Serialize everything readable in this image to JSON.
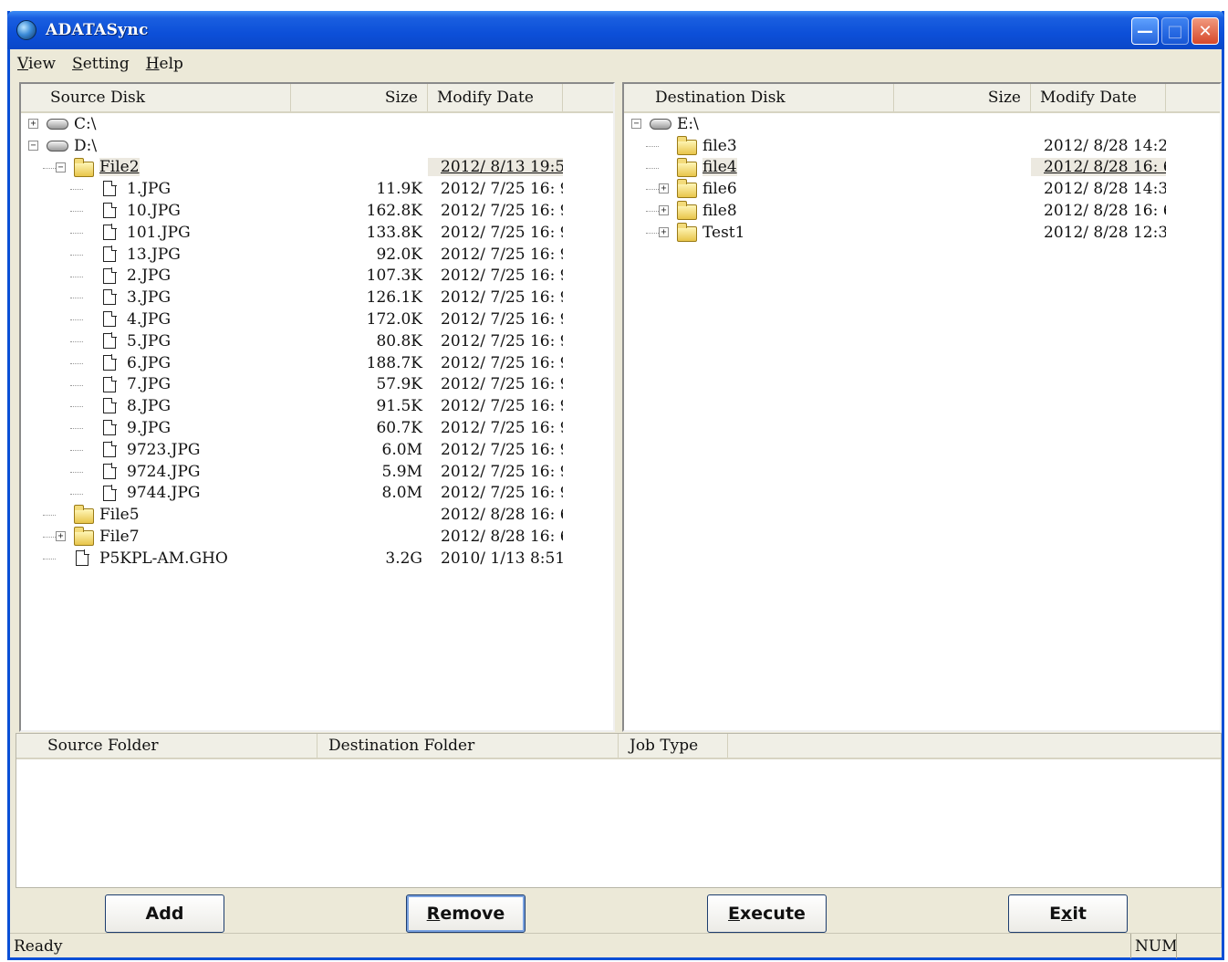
{
  "window": {
    "title": "ADATASync"
  },
  "menu": [
    "View",
    "Setting",
    "Help"
  ],
  "source": {
    "headers": {
      "name": "Source Disk",
      "size": "Size",
      "date": "Modify Date"
    },
    "rows": [
      {
        "depth": 0,
        "type": "drive",
        "expander": "+",
        "name": "C:\\",
        "size": "",
        "date": ""
      },
      {
        "depth": 0,
        "type": "drive",
        "expander": "-",
        "name": "D:\\",
        "size": "",
        "date": ""
      },
      {
        "depth": 1,
        "type": "folder-open",
        "expander": "-",
        "name": "File2",
        "size": "",
        "date": "2012/ 8/13 19:5...",
        "selected": true
      },
      {
        "depth": 2,
        "type": "file",
        "name": "1.JPG",
        "size": "11.9K",
        "date": "2012/ 7/25 16: 9..."
      },
      {
        "depth": 2,
        "type": "file",
        "name": "10.JPG",
        "size": "162.8K",
        "date": "2012/ 7/25 16: 9..."
      },
      {
        "depth": 2,
        "type": "file",
        "name": "101.JPG",
        "size": "133.8K",
        "date": "2012/ 7/25 16: 9..."
      },
      {
        "depth": 2,
        "type": "file",
        "name": "13.JPG",
        "size": "92.0K",
        "date": "2012/ 7/25 16: 9..."
      },
      {
        "depth": 2,
        "type": "file",
        "name": "2.JPG",
        "size": "107.3K",
        "date": "2012/ 7/25 16: 9..."
      },
      {
        "depth": 2,
        "type": "file",
        "name": "3.JPG",
        "size": "126.1K",
        "date": "2012/ 7/25 16: 9..."
      },
      {
        "depth": 2,
        "type": "file",
        "name": "4.JPG",
        "size": "172.0K",
        "date": "2012/ 7/25 16: 9..."
      },
      {
        "depth": 2,
        "type": "file",
        "name": "5.JPG",
        "size": "80.8K",
        "date": "2012/ 7/25 16: 9..."
      },
      {
        "depth": 2,
        "type": "file",
        "name": "6.JPG",
        "size": "188.7K",
        "date": "2012/ 7/25 16: 9..."
      },
      {
        "depth": 2,
        "type": "file",
        "name": "7.JPG",
        "size": "57.9K",
        "date": "2012/ 7/25 16: 9..."
      },
      {
        "depth": 2,
        "type": "file",
        "name": "8.JPG",
        "size": "91.5K",
        "date": "2012/ 7/25 16: 9..."
      },
      {
        "depth": 2,
        "type": "file",
        "name": "9.JPG",
        "size": "60.7K",
        "date": "2012/ 7/25 16: 9..."
      },
      {
        "depth": 2,
        "type": "file",
        "name": "9723.JPG",
        "size": "6.0M",
        "date": "2012/ 7/25 16: 9..."
      },
      {
        "depth": 2,
        "type": "file",
        "name": "9724.JPG",
        "size": "5.9M",
        "date": "2012/ 7/25 16: 9..."
      },
      {
        "depth": 2,
        "type": "file",
        "name": "9744.JPG",
        "size": "8.0M",
        "date": "2012/ 7/25 16: 9..."
      },
      {
        "depth": 1,
        "type": "folder",
        "name": "File5",
        "size": "",
        "date": "2012/ 8/28 16: 6..."
      },
      {
        "depth": 1,
        "type": "folder",
        "expander": "+",
        "name": "File7",
        "size": "",
        "date": "2012/ 8/28 16: 6..."
      },
      {
        "depth": 1,
        "type": "file",
        "name": "P5KPL-AM.GHO",
        "size": "3.2G",
        "date": "2010/ 1/13 8:51..."
      }
    ]
  },
  "destination": {
    "headers": {
      "name": "Destination Disk",
      "size": "Size",
      "date": "Modify Date"
    },
    "rows": [
      {
        "depth": 0,
        "type": "drive",
        "expander": "-",
        "name": "E:\\",
        "size": "",
        "date": ""
      },
      {
        "depth": 1,
        "type": "folder",
        "name": "file3",
        "size": "",
        "date": "2012/ 8/28 14:2..."
      },
      {
        "depth": 1,
        "type": "folder-open",
        "name": "file4",
        "size": "",
        "date": "2012/ 8/28 16: 6...",
        "selected": true
      },
      {
        "depth": 1,
        "type": "folder",
        "expander": "+",
        "name": "file6",
        "size": "",
        "date": "2012/ 8/28 14:3..."
      },
      {
        "depth": 1,
        "type": "folder",
        "expander": "+",
        "name": "file8",
        "size": "",
        "date": "2012/ 8/28 16: 6..."
      },
      {
        "depth": 1,
        "type": "folder",
        "expander": "+",
        "name": "Test1",
        "size": "",
        "date": "2012/ 8/28 12:3..."
      }
    ]
  },
  "jobs": {
    "headers": {
      "source": "Source Folder",
      "destination": "Destination Folder",
      "type": "Job Type"
    }
  },
  "buttons": {
    "add": "Add",
    "remove": {
      "u": "R",
      "rest": "emove"
    },
    "execute": {
      "u": "E",
      "rest": "xecute"
    },
    "exit": {
      "pre": "E",
      "u": "x",
      "rest": "it"
    }
  },
  "status": {
    "text": "Ready",
    "num": "NUM"
  }
}
